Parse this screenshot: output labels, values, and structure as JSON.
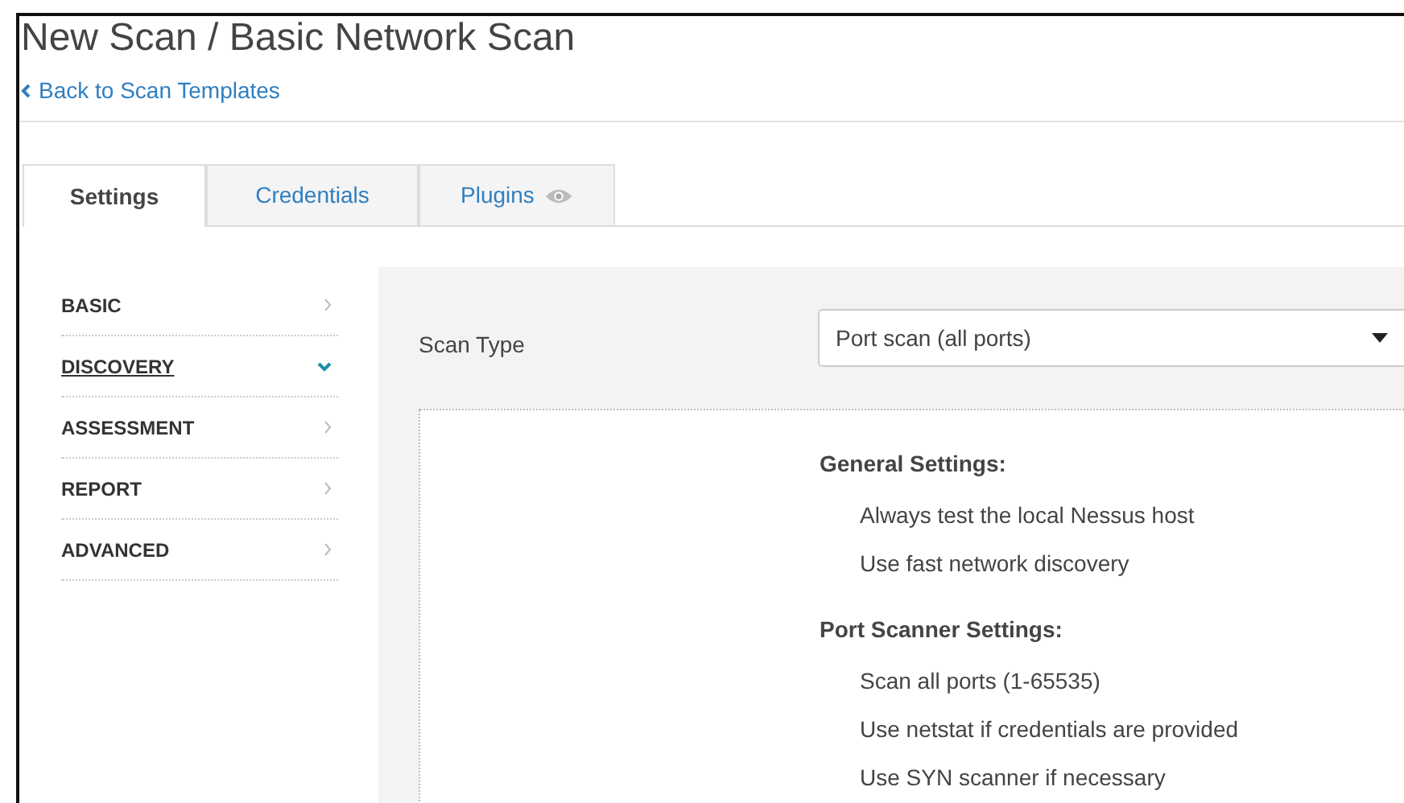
{
  "page": {
    "title": "New Scan / Basic Network Scan",
    "back_link": "Back to Scan Templates"
  },
  "tabs": [
    {
      "label": "Settings",
      "selected": true,
      "icon": false
    },
    {
      "label": "Credentials",
      "selected": false,
      "icon": false
    },
    {
      "label": "Plugins",
      "selected": false,
      "icon": true
    }
  ],
  "sidebar": {
    "items": [
      {
        "label": "BASIC",
        "selected": false
      },
      {
        "label": "DISCOVERY",
        "selected": true
      },
      {
        "label": "ASSESSMENT",
        "selected": false
      },
      {
        "label": "REPORT",
        "selected": false
      },
      {
        "label": "ADVANCED",
        "selected": false
      }
    ]
  },
  "scan_type": {
    "label": "Scan Type",
    "value": "Port scan (all ports)"
  },
  "summary": [
    {
      "heading": "General Settings:",
      "items": [
        "Always test the local Nessus host",
        "Use fast network discovery"
      ]
    },
    {
      "heading": "Port Scanner Settings:",
      "items": [
        "Scan all ports (1-65535)",
        "Use netstat if credentials are provided",
        "Use SYN scanner if necessary"
      ]
    }
  ]
}
